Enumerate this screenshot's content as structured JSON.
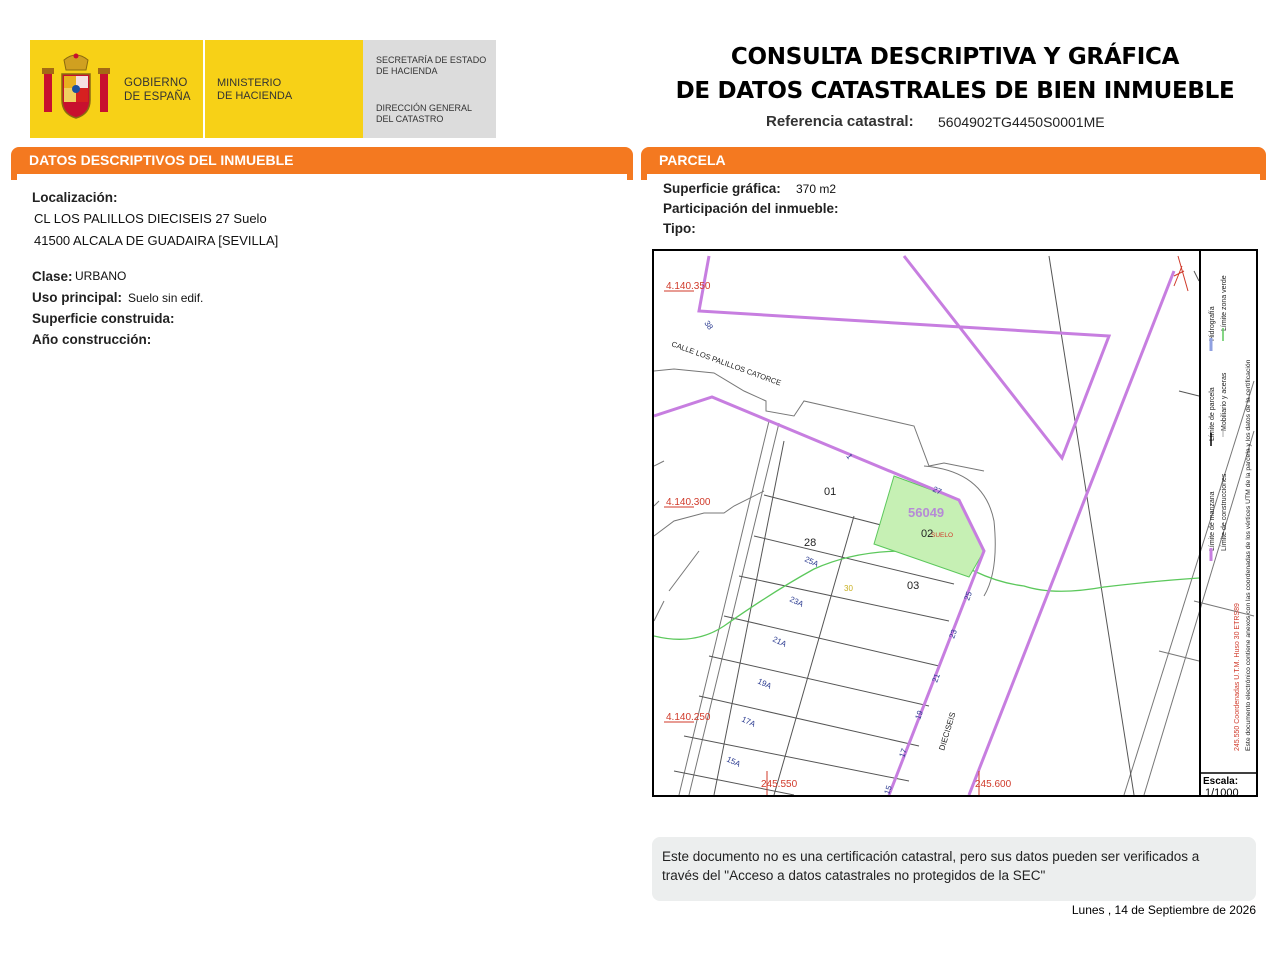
{
  "header": {
    "gobierno": [
      "GOBIERNO",
      "DE ESPAÑA"
    ],
    "ministerio": [
      "MINISTERIO",
      "DE HACIENDA"
    ],
    "secretaria": [
      "SECRETARÍA DE ESTADO",
      "DE HACIENDA"
    ],
    "direccion": [
      "DIRECCIÓN GENERAL",
      "DEL CATASTRO"
    ],
    "title_line1": "CONSULTA DESCRIPTIVA Y GRÁFICA",
    "title_line2": "DE DATOS CATASTRALES DE BIEN INMUEBLE",
    "ref_label": "Referencia catastral:",
    "ref_value": "5604902TG4450S0001ME"
  },
  "descriptivos": {
    "heading": "DATOS DESCRIPTIVOS DEL INMUEBLE",
    "localizacion_label": "Localización:",
    "localizacion_line1": "CL LOS PALILLOS DIECISEIS 27 Suelo",
    "localizacion_line2": "41500 ALCALA DE GUADAIRA [SEVILLA]",
    "clase_label": "Clase:",
    "clase_value": "URBANO",
    "uso_label": "Uso principal:",
    "uso_value": "Suelo sin edif.",
    "superficie_construida_label": "Superficie construida:",
    "anio_label": "Año construcción:"
  },
  "parcela": {
    "heading": "PARCELA",
    "superficie_label": "Superficie gráfica:",
    "superficie_value": "370 m2",
    "participacion_label": "Participación del inmueble:",
    "tipo_label": "Tipo:"
  },
  "map": {
    "coords": {
      "y_top": "4.140.350",
      "y_mid": "4.140.300",
      "y_bot": "4.140.250",
      "x_left": "245.550",
      "x_right": "245.600"
    },
    "street_catorce": "CALLE LOS PALILLOS CATORCE",
    "street_dieciseis": "DIECISEIS",
    "parcel_code": "56049",
    "suelo": "SUELO",
    "lot_labels": [
      "01",
      "02",
      "03",
      "28"
    ],
    "numbers": [
      "38",
      "1",
      "27",
      "25A",
      "23A",
      "21A",
      "19A",
      "17A",
      "15A",
      "25",
      "23",
      "21",
      "19",
      "17",
      "15",
      "30"
    ],
    "legend": {
      "col1_a": "Límite de manzana",
      "col1_b": "Límite de parcela",
      "col1_c": "Hidrografía",
      "col2_a": "Límite de construcciones",
      "col2_b": "Mobiliario y aceras",
      "col2_c": "Límite zona verde",
      "coords_note": "245.550 Coordenadas U.T.M. Huso 30 ETRS89",
      "cert_note": "Este documento electrónico contiene anexos con las coordenadas de los vértices UTM de la parcela y los datos de la certificación"
    },
    "escala_label": "Escala:",
    "escala_value": "1/1000",
    "colors": {
      "manzana": "#c77ee0",
      "zona_verde": "#5cc85c",
      "parcela_fill": "#c6f0b4",
      "coord_text": "#d03a2a"
    }
  },
  "note": {
    "line1": "Este documento no es una certificación catastral, pero sus datos pueden ser verificados a",
    "line2": "través del \"Acceso a datos catastrales no protegidos de la SEC\""
  },
  "date": "Lunes , 14 de Septiembre de 2026",
  "colors": {
    "accent": "#f47920",
    "logo_yellow": "#f7d117"
  }
}
